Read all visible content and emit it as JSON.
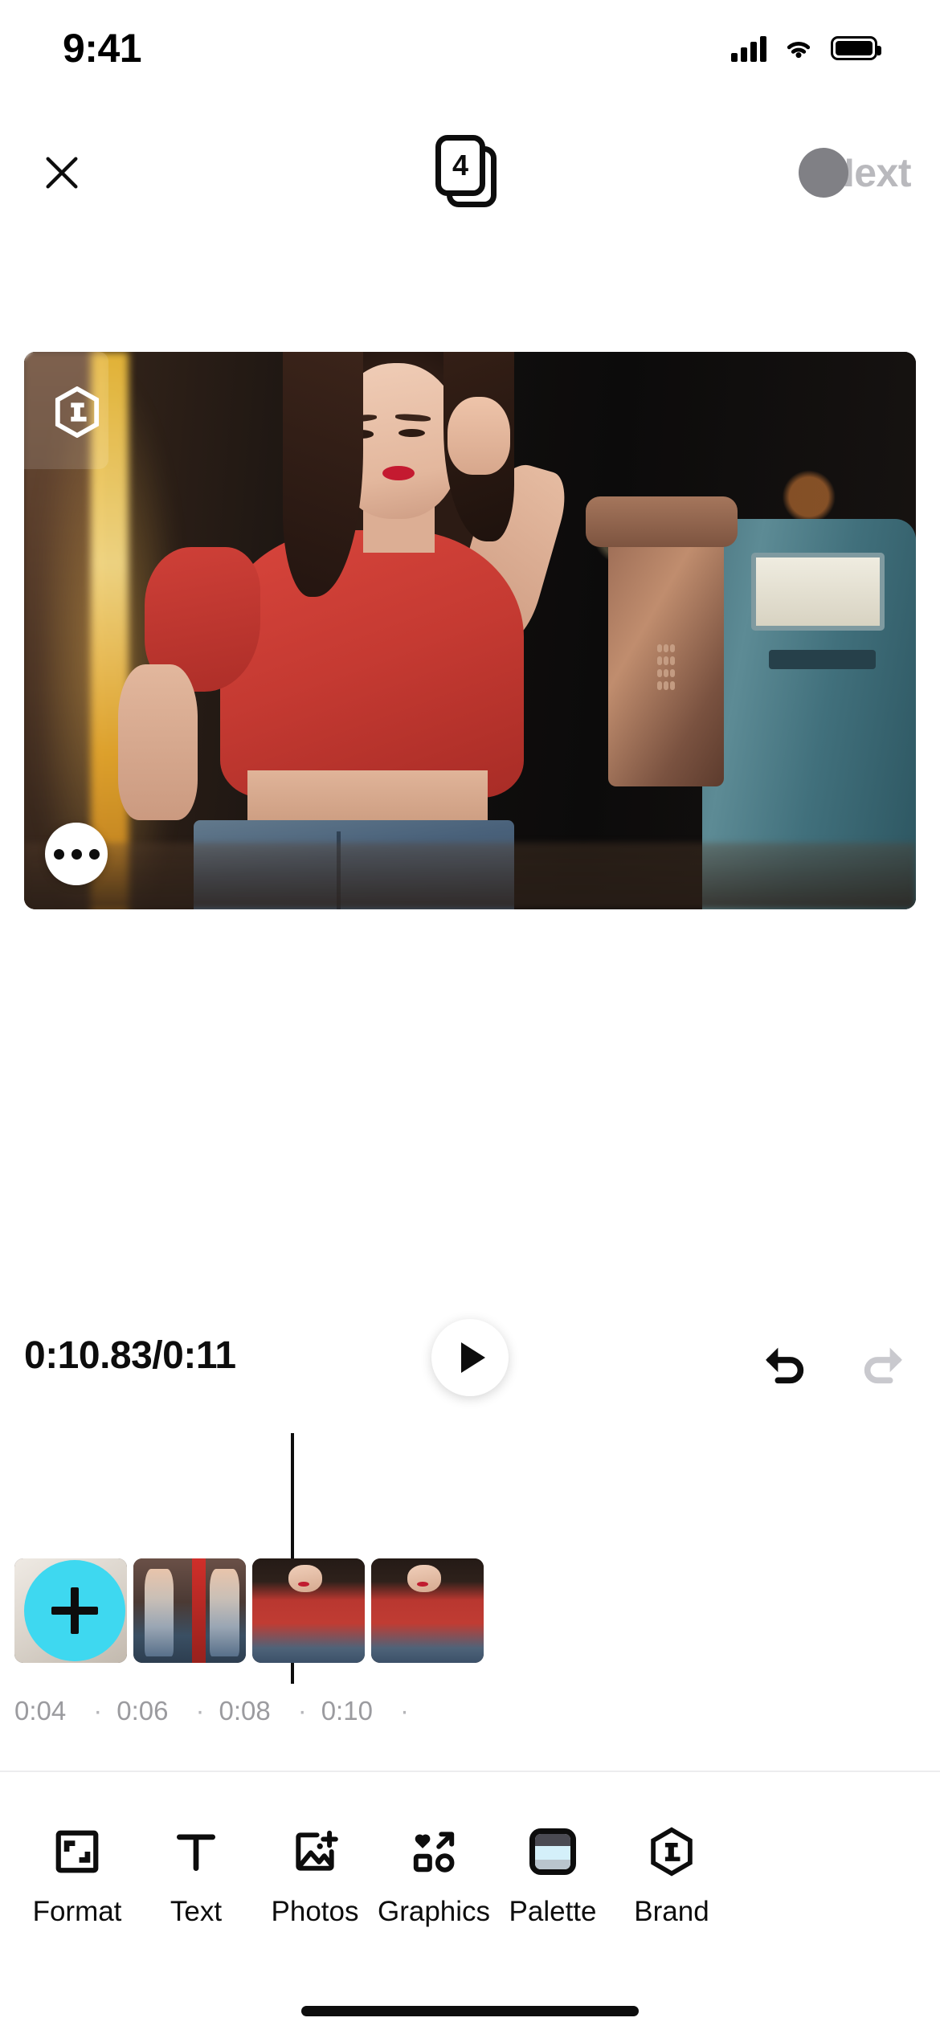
{
  "status_bar": {
    "time": "9:41",
    "cellular_icon": "cellular-signal-icon",
    "wifi_icon": "wifi-icon",
    "battery_icon": "battery-full-icon"
  },
  "nav_bar": {
    "close_icon": "close-x-icon",
    "pages_badge": {
      "icon": "stacked-pages-icon",
      "count": "4"
    },
    "next_label": "Next",
    "next_state": "disabled",
    "spinner_icon": "loading-spinner-icon",
    "next_color": "#b9b9bd",
    "spinner_color": "#808085"
  },
  "canvas": {
    "watermark": {
      "icon": "hexagon-l-logo-icon",
      "letter": "L"
    },
    "more_options_icon": "more-horizontal-icon"
  },
  "controls": {
    "timecode": "0:10.83/0:11",
    "current_time": "0:10.83",
    "total_time": "0:11",
    "play_icon": "play-icon",
    "undo_icon": "undo-icon",
    "redo_icon": "redo-icon",
    "undo_state": "enabled",
    "redo_state": "disabled"
  },
  "timeline": {
    "add_clip_icon": "plus-icon",
    "add_button_color": "#3ed8f0",
    "playhead_position": "0:10.83",
    "clips": [
      {
        "name": "clip-1"
      },
      {
        "name": "clip-2"
      },
      {
        "name": "clip-3"
      },
      {
        "name": "clip-4"
      }
    ],
    "ruler_ticks": [
      "0:04",
      "0:06",
      "0:08",
      "0:10"
    ],
    "ruler_separator": "·"
  },
  "toolbar": {
    "items": [
      {
        "label": "Format",
        "icon": "format-frame-icon"
      },
      {
        "label": "Text",
        "icon": "text-t-icon"
      },
      {
        "label": "Photos",
        "icon": "add-photo-icon"
      },
      {
        "label": "Graphics",
        "icon": "graphics-shapes-icon"
      },
      {
        "label": "Palette",
        "icon": "color-palette-icon"
      },
      {
        "label": "Brand",
        "icon": "hexagon-l-brand-icon"
      }
    ]
  }
}
